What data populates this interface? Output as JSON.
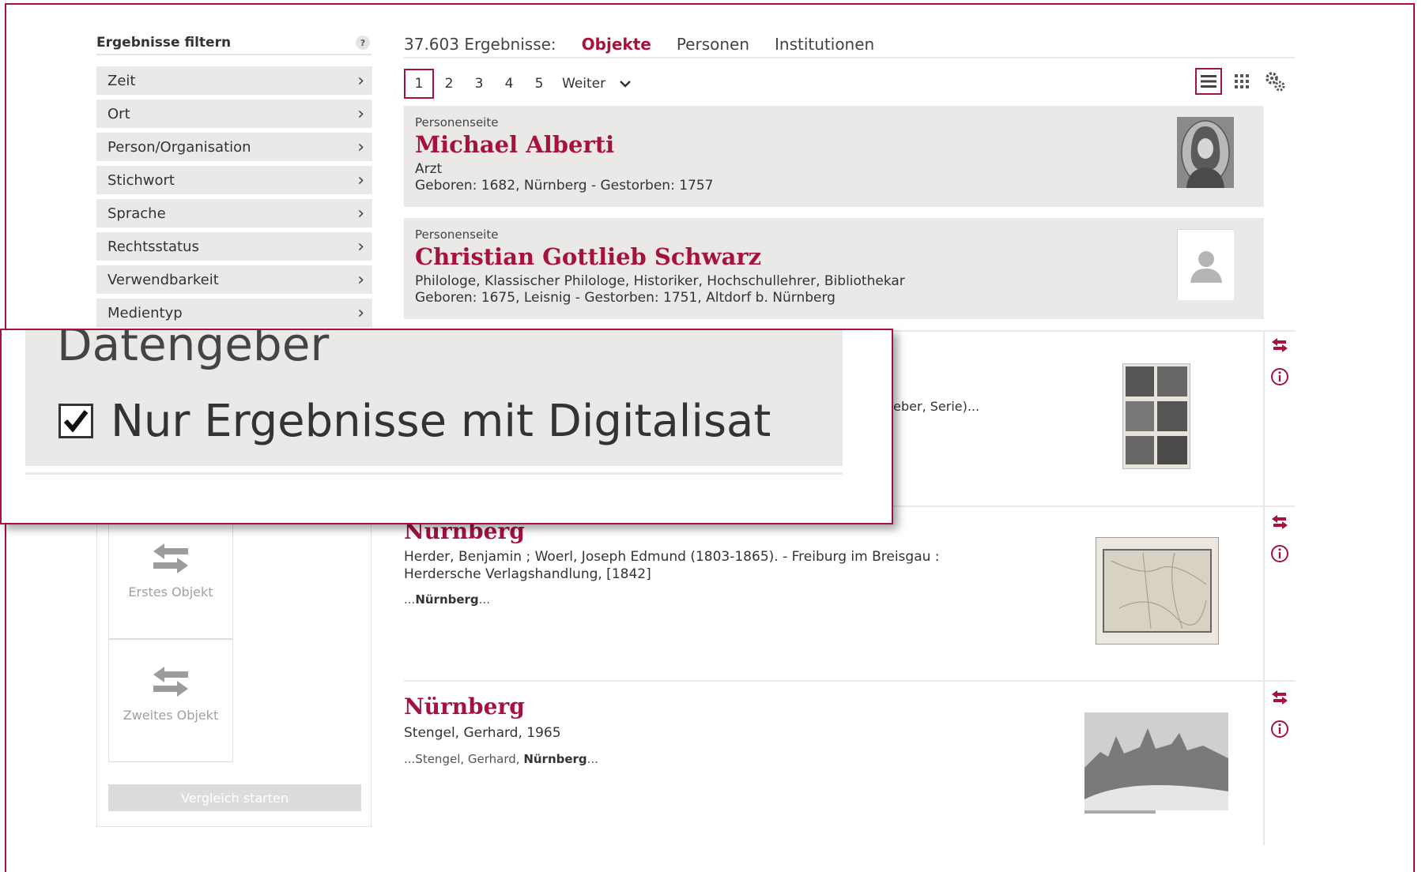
{
  "filter": {
    "title": "Ergebnisse filtern",
    "help": "?",
    "items": [
      {
        "label": "Zeit"
      },
      {
        "label": "Ort"
      },
      {
        "label": "Person/Organisation"
      },
      {
        "label": "Stichwort"
      },
      {
        "label": "Sprache"
      },
      {
        "label": "Rechtsstatus"
      },
      {
        "label": "Verwendbarkeit"
      },
      {
        "label": "Medientyp"
      }
    ],
    "chevron": "›"
  },
  "zoom": {
    "partial_label": "Datengeber",
    "checkbox_label": "Nur Ergebnisse mit Digitalisat",
    "checked": true
  },
  "compare": {
    "first": "Erstes Objekt",
    "second": "Zweites Objekt",
    "start": "Vergleich starten"
  },
  "results": {
    "count": "37.603 Ergebnisse:",
    "tabs": [
      {
        "label": "Objekte",
        "active": true
      },
      {
        "label": "Personen",
        "active": false
      },
      {
        "label": "Institutionen",
        "active": false
      }
    ],
    "pages": [
      "1",
      "2",
      "3",
      "4",
      "5"
    ],
    "next": "Weiter"
  },
  "persons": [
    {
      "kind": "Personenseite",
      "name": "Michael Alberti",
      "line1": "Arzt",
      "line2": "Geboren: 1682, Nürnberg - Gestorben: 1757"
    },
    {
      "kind": "Personenseite",
      "name": "Christian Gottlieb Schwarz",
      "line1": "Philologe, Klassischer Philologe, Historiker, Hochschullehrer, Bibliothekar",
      "line2": "Geboren: 1675, Leisnig - Gestorben: 1751, Altdorf b. Nürnberg"
    }
  ],
  "objects": [
    {
      "partial_text": "geber, Serie)..."
    },
    {
      "title": "Nürnberg",
      "text1": "Herder, Benjamin ; Woerl, Joseph Edmund (1803-1865). - Freiburg im Breisgau :",
      "text2": "Herdersche Verlagshandlung, [1842]",
      "snip_pre": "...",
      "snip_bold": "Nürnberg",
      "snip_post": "..."
    },
    {
      "title": "Nürnberg",
      "text1": "Stengel, Gerhard, 1965",
      "snip_pre": "...Stengel, Gerhard, ",
      "snip_bold": "Nürnberg",
      "snip_post": "..."
    }
  ],
  "colors": {
    "accent": "#a5123e",
    "panel": "#ebe9e7"
  }
}
